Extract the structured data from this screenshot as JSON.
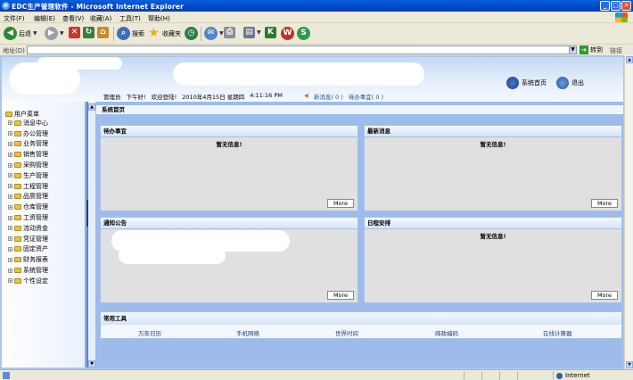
{
  "window": {
    "title": "EDC生产管理软件 - Microsoft Internet Explorer"
  },
  "menubar": [
    "文件(F)",
    "编辑(E)",
    "查看(V)",
    "收藏(A)",
    "工具(T)",
    "帮助(H)"
  ],
  "toolbar": {
    "back": "后退",
    "search": "搜索",
    "favorites": "收藏夹"
  },
  "address": {
    "label": "地址(D)",
    "value": "",
    "go": "转到",
    "links": "链接"
  },
  "header": {
    "role": "管理员",
    "greeting": "下午好!",
    "welcome": "欢迎登陆!",
    "date": "2010年4月15日 星期四",
    "time": "4:11:16 PM",
    "news": "新消息( 0 )",
    "todo": "待办事宜( 0 )",
    "home": "系统首页",
    "logout": "退出"
  },
  "sidebar": {
    "root": "用户菜单",
    "items": [
      "消息中心",
      "办公管理",
      "业务管理",
      "销售管理",
      "采购管理",
      "生产管理",
      "工程管理",
      "品质管理",
      "仓库管理",
      "工资管理",
      "流动资金",
      "凭证管理",
      "固定资产",
      "财务报表",
      "系统管理",
      "个性设定"
    ]
  },
  "main": {
    "section_title": "系统首页",
    "panels": [
      {
        "title": "待办事宜",
        "empty": "暂无信息!",
        "more": "More"
      },
      {
        "title": "最新消息",
        "empty": "暂无信息!",
        "more": "More"
      },
      {
        "title": "通知公告",
        "empty": "",
        "more": "More"
      },
      {
        "title": "日程安排",
        "empty": "暂无信息!",
        "more": "More"
      }
    ],
    "tools": {
      "title": "常用工具",
      "links": [
        "万年日历",
        "手机网络",
        "世界时间",
        "邮政编码",
        "在线计算器"
      ]
    }
  },
  "status": {
    "zone": "Internet"
  }
}
